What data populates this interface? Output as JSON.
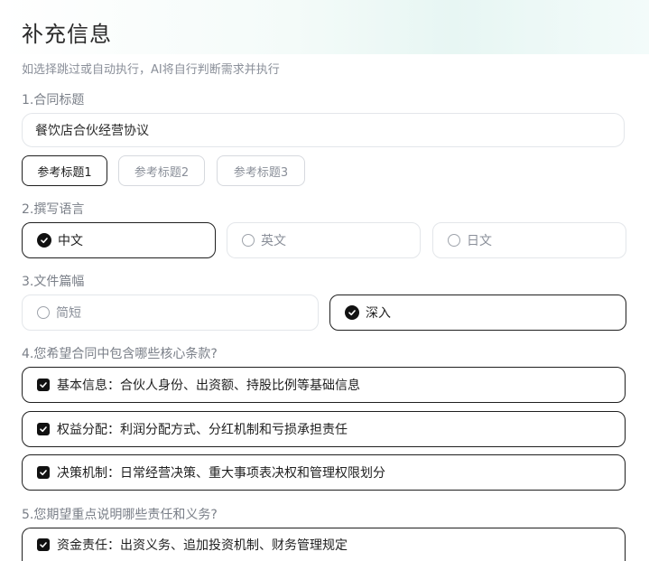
{
  "header": {
    "title": "补充信息",
    "hint": "如选择跳过或自动执行，AI将自行判断需求并执行"
  },
  "questions": {
    "q1": {
      "label": "1.合同标题",
      "input_value": "餐饮店合伙经营协议",
      "chips": [
        "参考标题1",
        "参考标题2",
        "参考标题3"
      ],
      "active_chip": "参考标题1"
    },
    "q2": {
      "label": "2.撰写语言",
      "options": [
        "中文",
        "英文",
        "日文"
      ],
      "selected": "中文"
    },
    "q3": {
      "label": "3.文件篇幅",
      "options": [
        "简短",
        "深入"
      ],
      "selected": "深入"
    },
    "q4": {
      "label": "4.您希望合同中包含哪些核心条款?",
      "items": [
        {
          "text": "基本信息：合伙人身份、出资额、持股比例等基础信息",
          "checked": true
        },
        {
          "text": "权益分配：利润分配方式、分红机制和亏损承担责任",
          "checked": true
        },
        {
          "text": "决策机制：日常经营决策、重大事项表决权和管理权限划分",
          "checked": true
        }
      ]
    },
    "q5": {
      "label": "5.您期望重点说明哪些责任和义务?",
      "items": [
        {
          "text": "资金责任：出资义务、追加投资机制、财务管理规定",
          "checked": true
        }
      ]
    }
  },
  "colors": {
    "accent": "#111111",
    "muted_text": "#8a8f99",
    "border": "#e3e6ea"
  },
  "icons": {
    "radio_selected": "check-circle-icon",
    "radio_unselected": "circle-icon",
    "checkbox_checked": "checkbox-checked-icon"
  }
}
